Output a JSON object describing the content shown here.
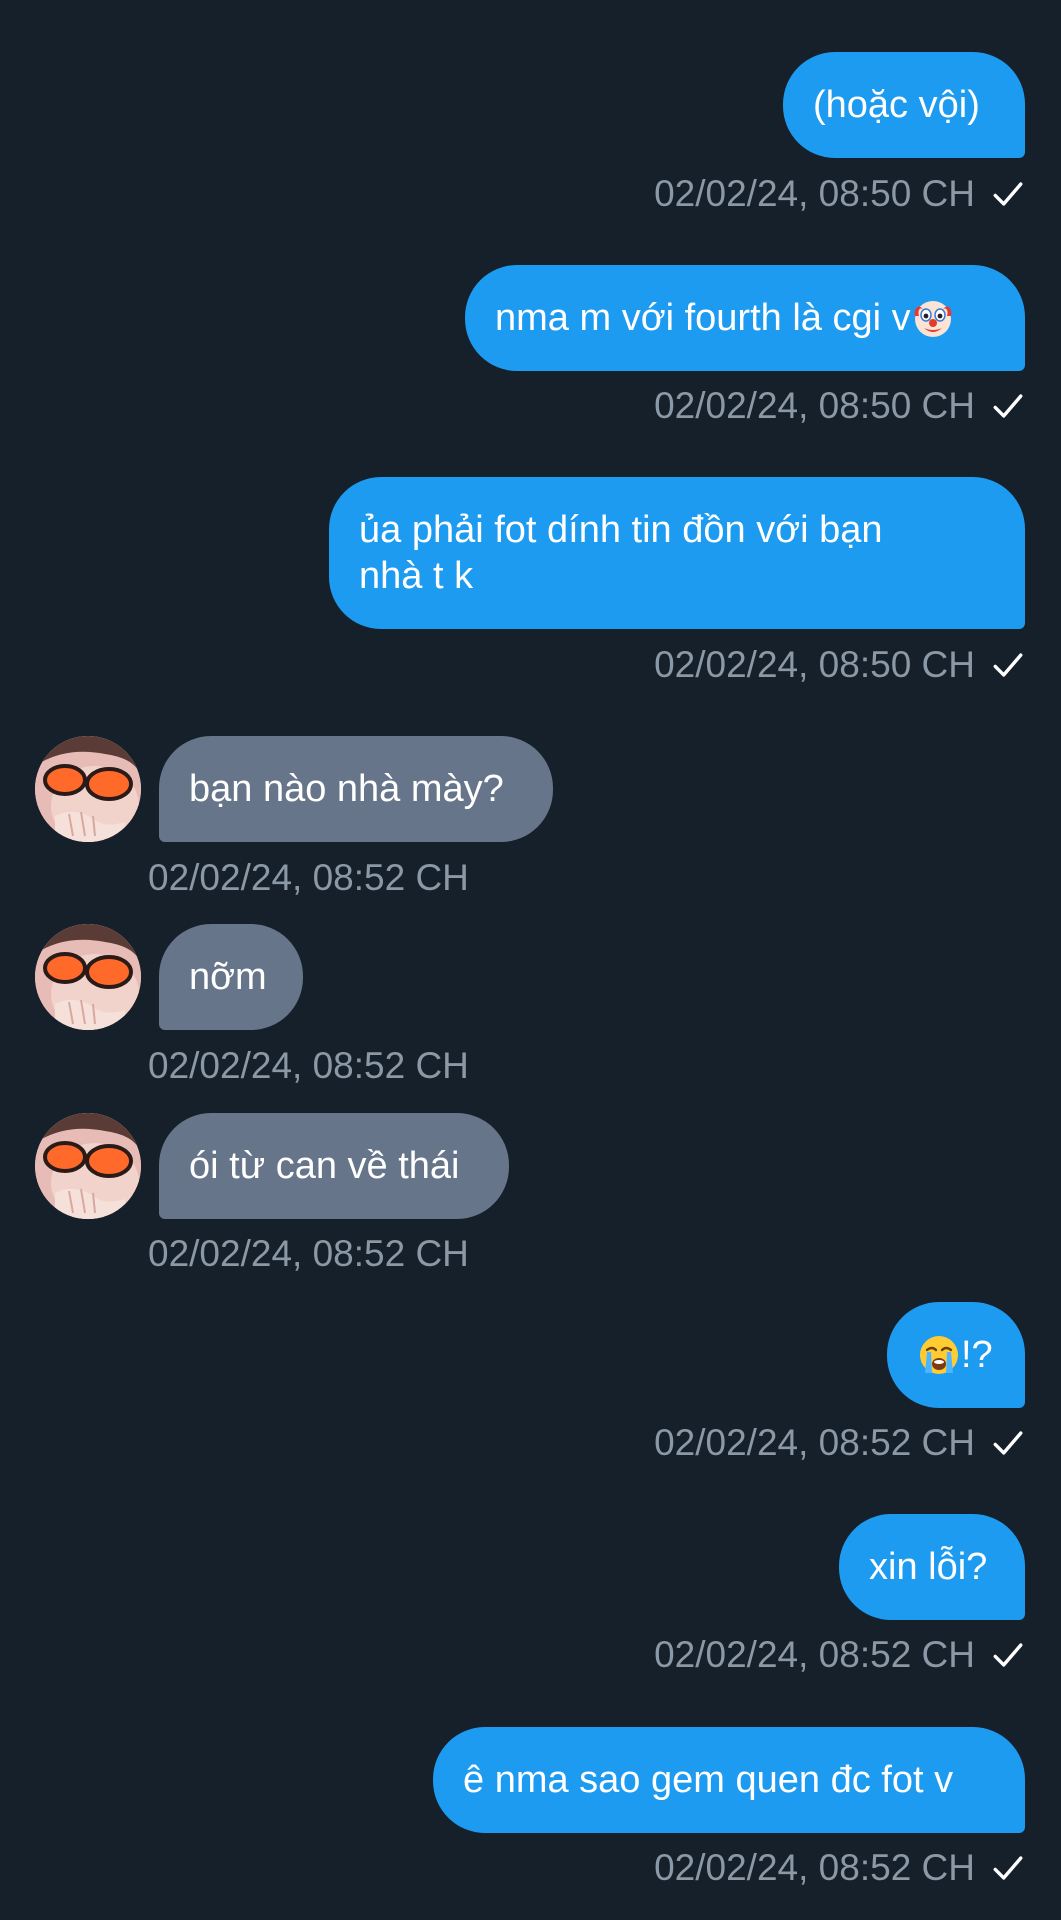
{
  "conversation": {
    "messages": [
      {
        "direction": "sent",
        "text": "(hoặc vội)",
        "timestamp": "02/02/24, 08:50 CH",
        "status": "check-icon"
      },
      {
        "direction": "sent",
        "text": "nma m với fourth là cgi v",
        "emoji": "clown-face-emoji",
        "timestamp": "02/02/24, 08:50 CH",
        "status": "check-icon"
      },
      {
        "direction": "sent",
        "text": "ủa phải fot dính tin đồn với bạn nhà t k",
        "timestamp": "02/02/24, 08:50 CH",
        "status": "check-icon"
      },
      {
        "direction": "received",
        "text": "bạn nào nhà mày?",
        "timestamp": "02/02/24, 08:52 CH",
        "avatar": "sunglasses-avatar"
      },
      {
        "direction": "received",
        "text": "nỡm",
        "timestamp": "02/02/24, 08:52 CH",
        "avatar": "sunglasses-avatar"
      },
      {
        "direction": "received",
        "text": "ói từ can về thái",
        "timestamp": "02/02/24, 08:52 CH",
        "avatar": "sunglasses-avatar"
      },
      {
        "direction": "sent",
        "text": "!?",
        "emoji": "loudly-crying-face-emoji",
        "timestamp": "02/02/24, 08:52 CH",
        "status": "check-icon"
      },
      {
        "direction": "sent",
        "text": "xin lỗi?",
        "timestamp": "02/02/24, 08:52 CH",
        "status": "check-icon"
      },
      {
        "direction": "sent",
        "text": "ê nma sao gem quen đc fot v",
        "timestamp": "02/02/24, 08:52 CH",
        "status": "check-icon"
      }
    ]
  },
  "colors": {
    "background": "#15202b",
    "sent_bubble": "#1d9bf0",
    "received_bubble": "#66758a",
    "timestamp_text": "#8b98a5",
    "message_text": "#ffffff"
  }
}
